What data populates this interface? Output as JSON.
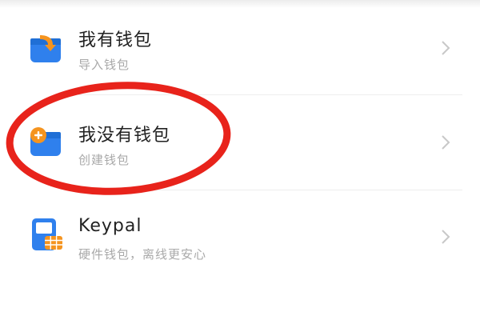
{
  "wallet_options": [
    {
      "title": "我有钱包",
      "subtitle": "导入钱包",
      "icon": "import-wallet-icon"
    },
    {
      "title": "我没有钱包",
      "subtitle": "创建钱包",
      "icon": "create-wallet-icon"
    },
    {
      "title": "Keypal",
      "subtitle": "硬件钱包，离线更安心",
      "icon": "hardware-wallet-icon"
    }
  ],
  "colors": {
    "icon_blue": "#2f80ed",
    "icon_orange": "#f5941f",
    "annotation_red": "#e8231b",
    "chevron": "#c8c8c8",
    "subtitle": "#a9a9a9"
  }
}
